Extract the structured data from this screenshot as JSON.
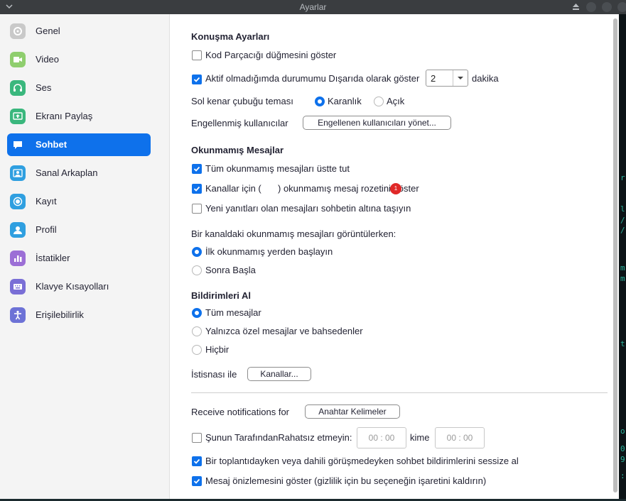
{
  "window": {
    "title": "Ayarlar"
  },
  "sidebar": {
    "items": [
      {
        "label": "Genel",
        "icon": "gear-icon",
        "color": "#c9c9c9"
      },
      {
        "label": "Video",
        "icon": "video-icon",
        "color": "#8fce6e"
      },
      {
        "label": "Ses",
        "icon": "headphones-icon",
        "color": "#3ab77d"
      },
      {
        "label": "Ekranı Paylaş",
        "icon": "share-screen-icon",
        "color": "#3ab77d"
      },
      {
        "label": "Sohbet",
        "icon": "chat-icon",
        "color": "#0e71eb",
        "active": true
      },
      {
        "label": "Sanal Arkaplan",
        "icon": "person-card-icon",
        "color": "#2f9fe0"
      },
      {
        "label": "Kayıt",
        "icon": "record-icon",
        "color": "#2f9fe0"
      },
      {
        "label": "Profil",
        "icon": "profile-icon",
        "color": "#2f9fe0"
      },
      {
        "label": "İstatikler",
        "icon": "stats-icon",
        "color": "#9c6fd6"
      },
      {
        "label": "Klavye Kısayolları",
        "icon": "keyboard-icon",
        "color": "#7a6fd6"
      },
      {
        "label": "Erişilebilirlik",
        "icon": "accessibility-icon",
        "color": "#6d72d6"
      }
    ]
  },
  "conversation": {
    "heading": "Konuşma Ayarları",
    "code_snippet_label": "Kod Parçacığı düğmesini göster",
    "code_snippet_checked": false,
    "away_label": "Aktif olmadığımda durumumu Dışarıda olarak göster",
    "away_checked": true,
    "away_minutes": "2",
    "away_unit": "dakika",
    "sidebar_theme_label": "Sol kenar çubuğu teması",
    "theme_dark": "Karanlık",
    "theme_light": "Açık",
    "theme_selected": "Karanlık",
    "blocked_label": "Engellenmiş kullanıcılar",
    "blocked_button": "Engellenen kullanıcıları yönet..."
  },
  "unread": {
    "heading": "Okunmamış Mesajlar",
    "keep_top_label": "Tüm okunmamış mesajları üstte tut",
    "keep_top_checked": true,
    "badge_label_part1": "Kanallar için (",
    "badge_label_part2": ") okunmamış mesaj rozetini göster",
    "badge_checked": true,
    "badge_count": "1",
    "move_bottom_label": "Yeni yanıtları olan mesajları sohbetin altına taşıyın",
    "move_bottom_checked": false,
    "view_question": "Bir kanaldaki okunmamış mesajları görüntülerken:",
    "start_first_label": "İlk okunmamış yerden başlayın",
    "start_later_label": "Sonra Başla",
    "view_selected": "İlk okunmamış yerden başlayın"
  },
  "notifications": {
    "heading": "Bildirimleri Al",
    "all_label": "Tüm mesajlar",
    "private_label": "Yalnızca özel mesajlar ve bahsedenler",
    "none_label": "Hiçbir",
    "selected": "Tüm mesajlar",
    "exception_label": "İstisnası ile",
    "channels_button": "Kanallar...",
    "receive_label": "Receive notifications for",
    "keywords_button": "Anahtar Kelimeler",
    "dnd_label": "Şunun TarafındanRahatsız etmeyin:",
    "dnd_checked": false,
    "dnd_from": "00 : 00",
    "dnd_until_label": "kime",
    "dnd_to": "00 : 00",
    "mute_label": "Bir toplantıdayken veya dahili görüşmedeyken sohbet bildirimlerini sessize al",
    "mute_checked": true,
    "preview_label": "Mesaj önizlemesini göster (gizlilik için bu seçeneğin işaretini kaldırın)",
    "preview_checked": true
  },
  "terminal": {
    "glyphs": [
      "r",
      "l",
      "/",
      "/",
      "m",
      "m",
      "t",
      "o",
      "0",
      "9",
      ":"
    ]
  }
}
